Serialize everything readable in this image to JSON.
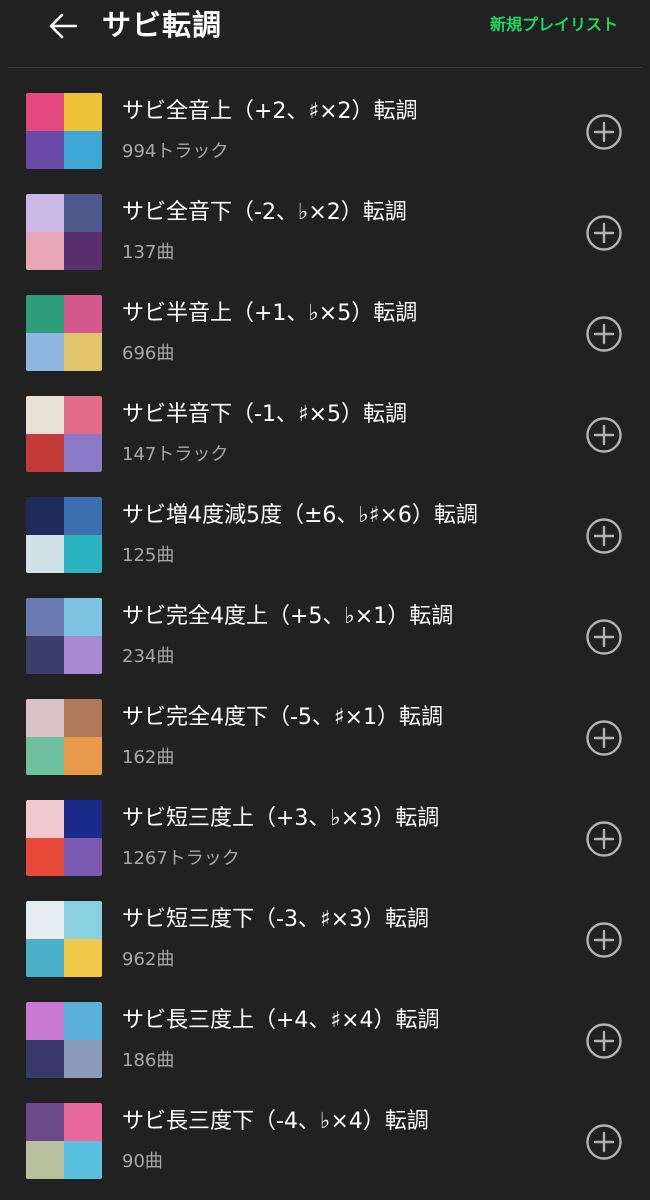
{
  "header": {
    "title": "サビ転調",
    "back_icon": "arrow-left-icon",
    "action_label": "新規プレイリスト",
    "action_color": "#1ed760"
  },
  "playlists": [
    {
      "title": "サビ全音上（+2、♯×2）転調",
      "count": "994トラック",
      "colors": [
        "#e3487e",
        "#f0c23a",
        "#6a4aa8",
        "#3fa7d8"
      ]
    },
    {
      "title": "サビ全音下（-2、♭×2）転調",
      "count": "137曲",
      "colors": [
        "#c9b8e6",
        "#4b5a8a",
        "#e8a7b9",
        "#5a2f6e"
      ]
    },
    {
      "title": "サビ半音上（+1、♭×5）転調",
      "count": "696曲",
      "colors": [
        "#2e9e7a",
        "#d45a8e",
        "#8fb6e0",
        "#e0c36a"
      ]
    },
    {
      "title": "サビ半音下（-1、♯×5）転調",
      "count": "147トラック",
      "colors": [
        "#e9e0d6",
        "#e26b8a",
        "#c23a3a",
        "#8a7ac8"
      ]
    },
    {
      "title": "サビ増4度減5度（±6、♭♯×6）転調",
      "count": "125曲",
      "colors": [
        "#1e2a5a",
        "#3b6fb0",
        "#cfe2e8",
        "#2bb3c0"
      ]
    },
    {
      "title": "サビ完全4度上（+5、♭×1）転調",
      "count": "234曲",
      "colors": [
        "#6a7ab0",
        "#7fc4e0",
        "#3a3f6a",
        "#a88ad0"
      ]
    },
    {
      "title": "サビ完全4度下（-5、♯×1）転調",
      "count": "162曲",
      "colors": [
        "#d9c1c8",
        "#b07a5a",
        "#6ec0a0",
        "#e89a4a"
      ]
    },
    {
      "title": "サビ短三度上（+3、♭×3）転調",
      "count": "1267トラック",
      "colors": [
        "#f0c8d2",
        "#1c2a8a",
        "#e84a3a",
        "#7a5ab0"
      ]
    },
    {
      "title": "サビ短三度下（-3、♯×3）転調",
      "count": "962曲",
      "colors": [
        "#e6eef2",
        "#8ad0e0",
        "#4ab0c8",
        "#f0c84a"
      ]
    },
    {
      "title": "サビ長三度上（+4、♯×4）転調",
      "count": "186曲",
      "colors": [
        "#c87ad0",
        "#5ab0d8",
        "#3a3a6a",
        "#8a9ab8"
      ]
    },
    {
      "title": "サビ長三度下（-4、♭×4）転調",
      "count": "90曲",
      "colors": [
        "#6a4a8a",
        "#e86a9a",
        "#b8c0a0",
        "#5ac0e0"
      ]
    }
  ],
  "add_icon": "plus-circle-icon"
}
